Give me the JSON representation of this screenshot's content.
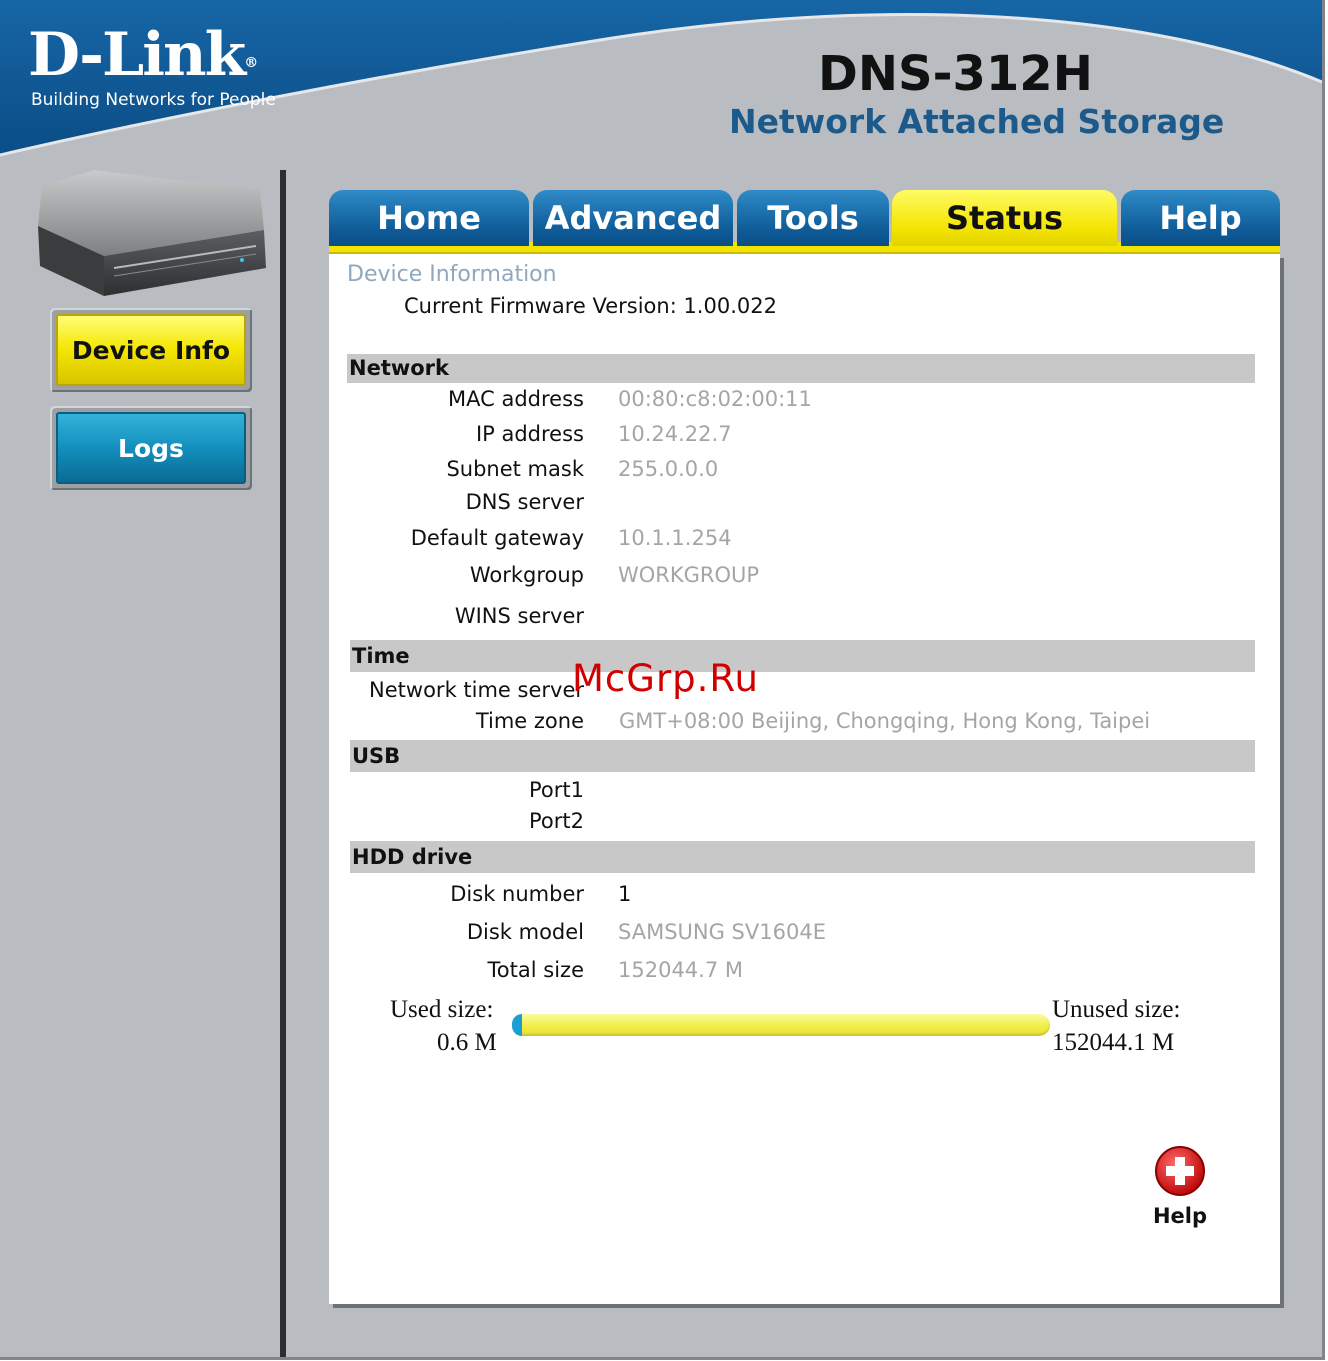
{
  "brand": {
    "logo": "D-Link",
    "registered": "®",
    "tagline": "Building Networks for People",
    "model": "DNS-312H",
    "product": "Network Attached Storage"
  },
  "tabs": [
    {
      "label": "Home",
      "active": false
    },
    {
      "label": "Advanced",
      "active": false
    },
    {
      "label": "Tools",
      "active": false
    },
    {
      "label": "Status",
      "active": true
    },
    {
      "label": "Help",
      "active": false
    }
  ],
  "sidebar": {
    "device_info": "Device Info",
    "logs": "Logs"
  },
  "page": {
    "title": "Device Information",
    "firmware": "Current Firmware Version: 1.00.022"
  },
  "network": {
    "heading": "Network",
    "rows": [
      {
        "label": "MAC address",
        "value": "00:80:c8:02:00:11"
      },
      {
        "label": "IP address",
        "value": "10.24.22.7"
      },
      {
        "label": "Subnet mask",
        "value": "255.0.0.0"
      },
      {
        "label": "DNS server",
        "value": ""
      },
      {
        "label": "Default gateway",
        "value": "10.1.1.254"
      },
      {
        "label": "Workgroup",
        "value": "WORKGROUP"
      },
      {
        "label": "WINS server",
        "value": ""
      }
    ]
  },
  "time": {
    "heading": "Time",
    "rows": [
      {
        "label": "Network time server",
        "value": ""
      },
      {
        "label": "Time zone",
        "value": "GMT+08:00 Beijing, Chongqing, Hong Kong, Taipei"
      }
    ]
  },
  "usb": {
    "heading": "USB",
    "rows": [
      {
        "label": "Port1",
        "value": ""
      },
      {
        "label": "Port2",
        "value": ""
      }
    ]
  },
  "hdd": {
    "heading": "HDD drive",
    "rows": [
      {
        "label": "Disk number",
        "value": "1"
      },
      {
        "label": "Disk model",
        "value": "SAMSUNG SV1604E"
      },
      {
        "label": "Total size",
        "value": "152044.7 M"
      }
    ],
    "used_label": "Used size:",
    "used_value": "0.6 M",
    "unused_label": "Unused size:",
    "unused_value": "152044.1 M",
    "used_fraction": 4e-06
  },
  "help_button": {
    "label": "Help",
    "icon": "plus-circle-icon"
  },
  "watermark": "McGrp.Ru",
  "colors": {
    "header_blue": "#0d5a94",
    "tab_active": "#f3e400",
    "tab_inactive": "#0f5c99",
    "accent_value": "#a5a5a5"
  }
}
